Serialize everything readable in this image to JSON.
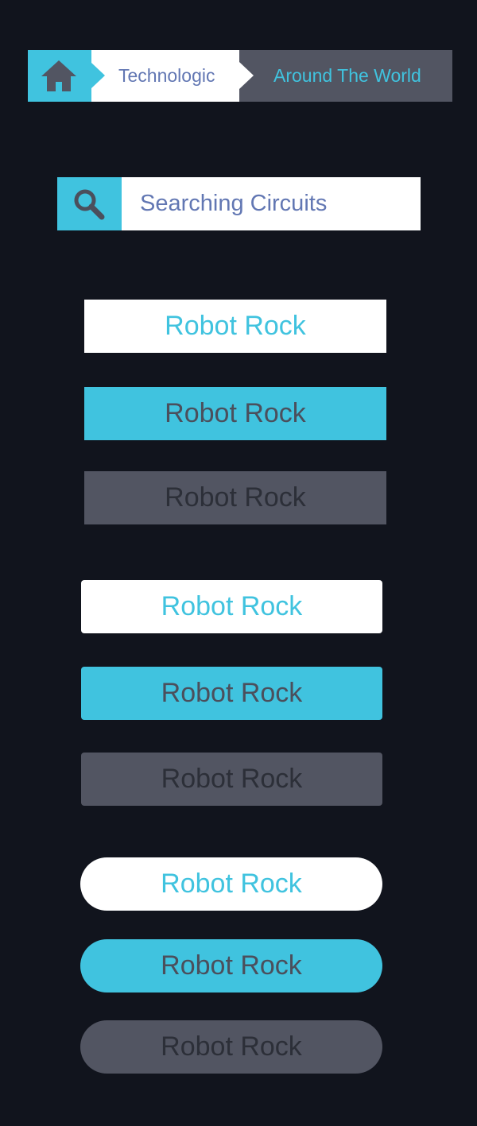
{
  "breadcrumb": {
    "home_icon": "home-icon",
    "items": [
      {
        "label": "Technologic"
      },
      {
        "label": "Around The World"
      }
    ]
  },
  "search": {
    "icon": "search-icon",
    "placeholder": "Searching Circuits"
  },
  "buttons": {
    "square": [
      {
        "label": "Robot Rock",
        "style": "white"
      },
      {
        "label": "Robot Rock",
        "style": "blue"
      },
      {
        "label": "Robot Rock",
        "style": "gray"
      }
    ],
    "rounded": [
      {
        "label": "Robot Rock",
        "style": "white"
      },
      {
        "label": "Robot Rock",
        "style": "blue"
      },
      {
        "label": "Robot Rock",
        "style": "gray"
      }
    ],
    "pill": [
      {
        "label": "Robot Rock",
        "style": "white"
      },
      {
        "label": "Robot Rock",
        "style": "blue"
      },
      {
        "label": "Robot Rock",
        "style": "gray"
      }
    ]
  },
  "colors": {
    "background": "#11141d",
    "accent": "#40c3df",
    "white": "#ffffff",
    "gray": "#525562",
    "breadcrumb_text": "#6277b3",
    "dark_text": "#4b4f5c"
  }
}
